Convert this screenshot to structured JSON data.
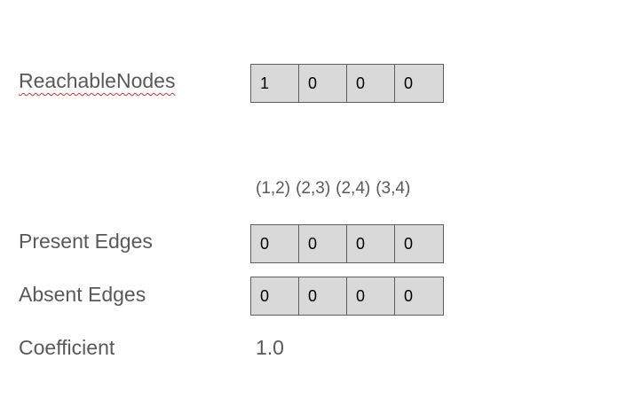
{
  "reachable": {
    "label": "ReachableNodes",
    "cells": [
      "1",
      "0",
      "0",
      "0"
    ]
  },
  "edge_list": [
    "(1,2)",
    "(2,3)",
    "(2,4)",
    "(3,4)"
  ],
  "present": {
    "label": "Present Edges",
    "cells": [
      "0",
      "0",
      "0",
      "0"
    ]
  },
  "absent": {
    "label": "Absent Edges",
    "cells": [
      "0",
      "0",
      "0",
      "0"
    ]
  },
  "coefficient": {
    "label": "Coefficient",
    "value": "1.0"
  },
  "colors": {
    "label_text": "#595959",
    "cell_fill": "#d9d9d9",
    "cell_border": "#5f5f5f",
    "spellcheck_underline": "#e03030"
  }
}
